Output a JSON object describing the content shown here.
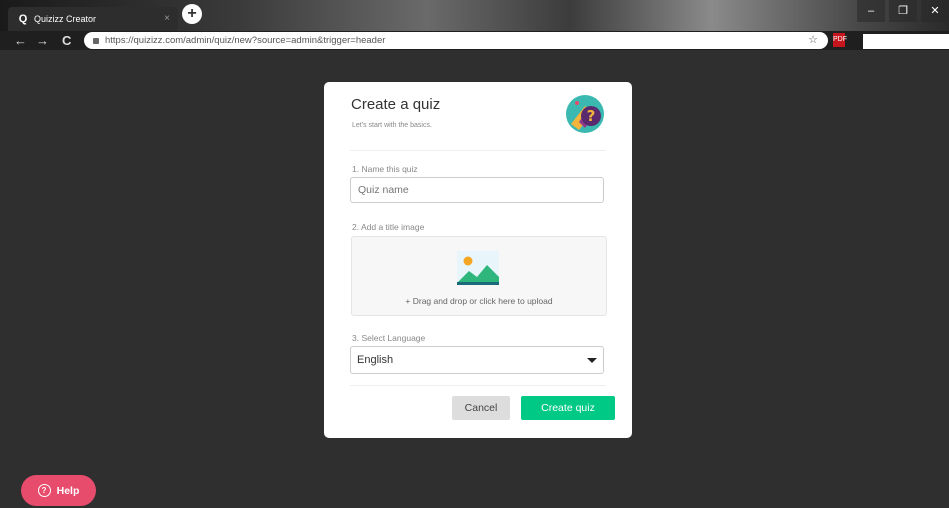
{
  "browser": {
    "tab_title": "Quizizz Creator",
    "tab_favicon": "Q",
    "tab_close": "×",
    "new_tab": "+",
    "window_minimize": "–",
    "window_restore": "❐",
    "window_close": "✕",
    "back": "←",
    "forward": "→",
    "reload": "C",
    "url": "https://quizizz.com/admin/quiz/new?source=admin&trigger=header",
    "star": "☆",
    "pdf_ext": "PDF"
  },
  "modal": {
    "title": "Create a quiz",
    "subtitle": "Let's start with the basics.",
    "logo_icon": "quiz-question-icon",
    "step1_label": "1. Name this quiz",
    "name_placeholder": "Quiz name",
    "name_value": "",
    "step2_label": "2. Add a title image",
    "upload_icon": "image-placeholder-icon",
    "upload_text": "+ Drag and drop or click here to upload",
    "step3_label": "3. Select Language",
    "language_value": "English",
    "cancel_label": "Cancel",
    "create_label": "Create quiz"
  },
  "help": {
    "label": "Help",
    "icon": "?"
  },
  "colors": {
    "accent_green": "#00c985",
    "help_pink": "#e74c6c",
    "background": "#2f2f2f"
  }
}
